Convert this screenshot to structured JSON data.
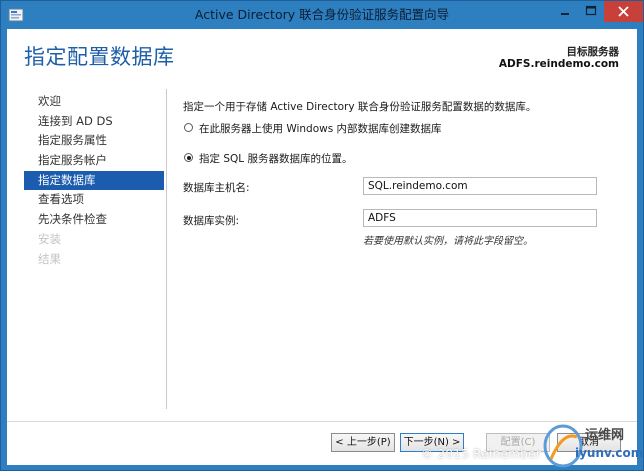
{
  "window": {
    "title": "Active Directory 联合身份验证服务配置向导",
    "icon": "adfs-app-icon",
    "controls": [
      "minimize-icon",
      "maximize-icon",
      "close-icon"
    ]
  },
  "header": {
    "page_title": "指定配置数据库",
    "target_label": "目标服务器",
    "target_value": "ADFS.reindemo.com"
  },
  "nav": {
    "items": [
      {
        "label": "欢迎",
        "state": "normal"
      },
      {
        "label": "连接到 AD DS",
        "state": "normal"
      },
      {
        "label": "指定服务属性",
        "state": "normal"
      },
      {
        "label": "指定服务帐户",
        "state": "normal"
      },
      {
        "label": "指定数据库",
        "state": "active"
      },
      {
        "label": "查看选项",
        "state": "normal"
      },
      {
        "label": "先决条件检查",
        "state": "normal"
      },
      {
        "label": "安装",
        "state": "disabled"
      },
      {
        "label": "结果",
        "state": "disabled"
      }
    ]
  },
  "content": {
    "intro": "指定一个用于存储 Active Directory 联合身份验证服务配置数据的数据库。",
    "option_wid": {
      "label": "在此服务器上使用 Windows 内部数据库创建数据库",
      "selected": false
    },
    "option_sql": {
      "label": "指定 SQL 服务器数据库的位置。",
      "selected": true
    },
    "host_label": "数据库主机名:",
    "host_value": "SQL.reindemo.com",
    "instance_label": "数据库实例:",
    "instance_value": "ADFS",
    "instance_hint": "若要使用默认实例，请将此字段留空。"
  },
  "footer": {
    "prev_label": "< 上一步(P)",
    "next_label": "下一步(N) >",
    "config_label": "配置(C)",
    "cancel_label": "取消"
  },
  "watermark": {
    "copyright": "© 2015 Reinember",
    "brand": "运维网",
    "site": "iyunv.com"
  },
  "colors": {
    "titlebar": "#2d7fc0",
    "accent_title": "#1f5fa8",
    "nav_active": "#1b5cae",
    "close_button": "#c7403a"
  }
}
